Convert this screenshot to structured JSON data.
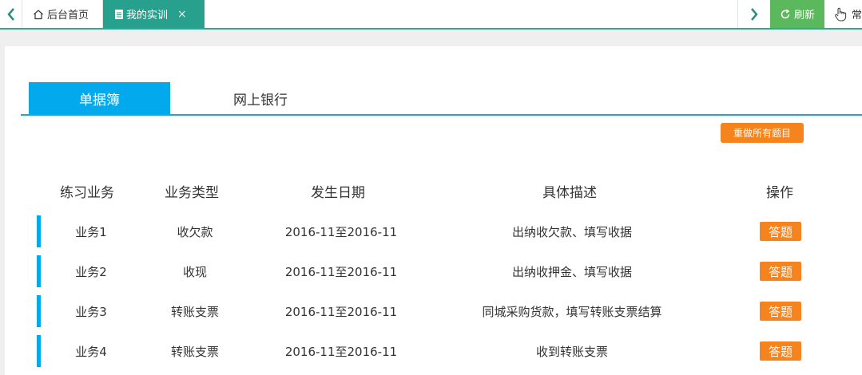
{
  "topbar": {
    "tabs": [
      {
        "label": "后台首页",
        "icon": "home-icon"
      },
      {
        "label": "我的实训",
        "icon": "document-icon",
        "close": "×"
      }
    ],
    "refresh_label": "刷新",
    "more_label": "常",
    "accent_color": "#27a08e",
    "refresh_color": "#5cb85c"
  },
  "subtabs": [
    {
      "label": "单据簿",
      "active": true
    },
    {
      "label": "网上银行",
      "active": false
    }
  ],
  "redo_button": "重做所有题目",
  "table": {
    "headers": [
      "练习业务",
      "业务类型",
      "发生日期",
      "具体描述",
      "操作"
    ],
    "rows": [
      {
        "business": "业务1",
        "type": "收欠款",
        "date": "2016-11至2016-11",
        "description": "出纳收欠款、填写收据",
        "action": "答题"
      },
      {
        "business": "业务2",
        "type": "收现",
        "date": "2016-11至2016-11",
        "description": "出纳收押金、填写收据",
        "action": "答题"
      },
      {
        "business": "业务3",
        "type": "转账支票",
        "date": "2016-11至2016-11",
        "description": "同城采购货款，填写转账支票结算",
        "action": "答题"
      },
      {
        "business": "业务4",
        "type": "转账支票",
        "date": "2016-11至2016-11",
        "description": "收到转账支票",
        "action": "答题"
      }
    ]
  },
  "colors": {
    "primary_blue": "#03a9ed",
    "orange": "#f5841f"
  }
}
